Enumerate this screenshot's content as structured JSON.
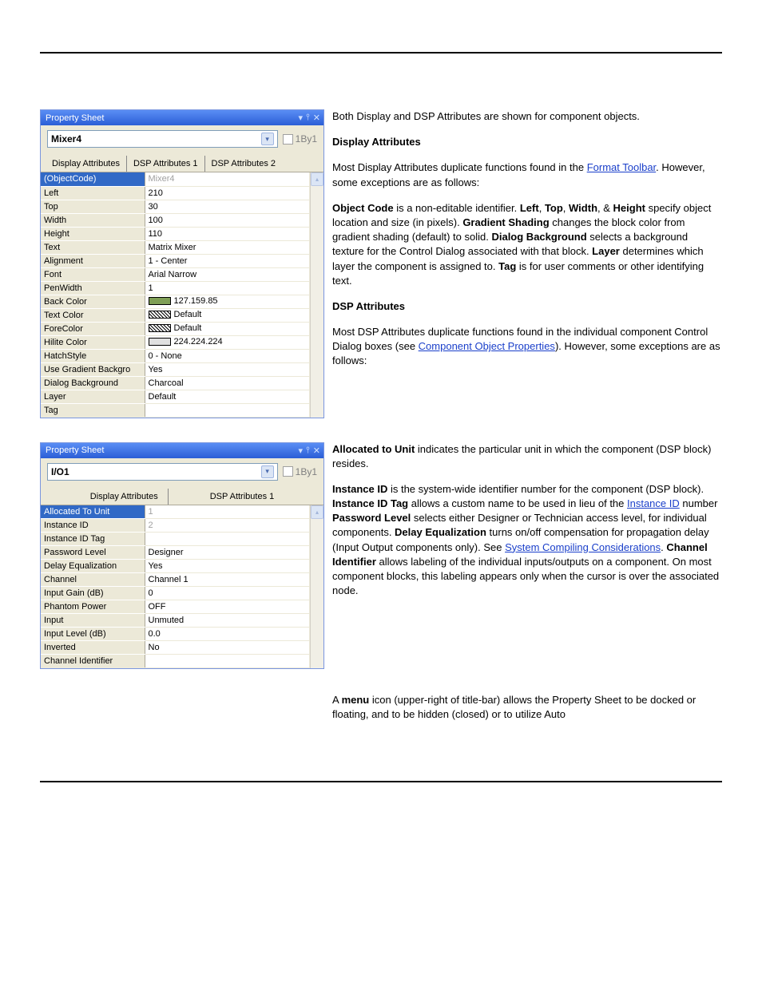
{
  "sheet1": {
    "title": "Property Sheet",
    "combo": "Mixer4",
    "by": "1By1",
    "tabs": [
      "Display Attributes",
      "DSP Attributes 1",
      "DSP Attributes 2"
    ],
    "rows": [
      {
        "name": "(ObjectCode)",
        "val": "Mixer4",
        "sel": true
      },
      {
        "name": "Left",
        "val": "210"
      },
      {
        "name": "Top",
        "val": "30"
      },
      {
        "name": "Width",
        "val": "100"
      },
      {
        "name": "Height",
        "val": "110"
      },
      {
        "name": "Text",
        "val": "Matrix Mixer"
      },
      {
        "name": "Alignment",
        "val": "1 - Center"
      },
      {
        "name": "Font",
        "val": "Arial Narrow"
      },
      {
        "name": "PenWidth",
        "val": "1"
      },
      {
        "name": "Back Color",
        "val": "127.159.85",
        "swatch": "#7f9f55"
      },
      {
        "name": "Text Color",
        "val": "Default",
        "swatch": "hatch"
      },
      {
        "name": "ForeColor",
        "val": "Default",
        "swatch": "hatch"
      },
      {
        "name": "Hilite Color",
        "val": "224.224.224",
        "swatch": "#e0e0e0"
      },
      {
        "name": "HatchStyle",
        "val": "0 - None"
      },
      {
        "name": "Use Gradient Backgro",
        "val": "Yes"
      },
      {
        "name": "Dialog Background",
        "val": "Charcoal"
      },
      {
        "name": "Layer",
        "val": "Default"
      },
      {
        "name": "Tag",
        "val": ""
      }
    ]
  },
  "sheet2": {
    "title": "Property Sheet",
    "combo": "I/O1",
    "by": "1By1",
    "tabs": [
      "Display Attributes",
      "DSP Attributes 1"
    ],
    "rows": [
      {
        "name": "Allocated To Unit",
        "val": "1",
        "sel": true
      },
      {
        "name": "Instance ID",
        "val": "2",
        "gray": true
      },
      {
        "name": "Instance ID Tag",
        "val": ""
      },
      {
        "name": "Password Level",
        "val": "Designer"
      },
      {
        "name": "Delay Equalization",
        "val": "Yes"
      },
      {
        "name": "Channel",
        "val": "Channel 1"
      },
      {
        "name": "Input Gain (dB)",
        "val": "0"
      },
      {
        "name": "Phantom Power",
        "val": "OFF"
      },
      {
        "name": "Input",
        "val": "Unmuted"
      },
      {
        "name": "Input Level (dB)",
        "val": "0.0"
      },
      {
        "name": "Inverted",
        "val": "No"
      },
      {
        "name": "Channel Identifier",
        "val": ""
      }
    ]
  },
  "txt": {
    "p1": "Both Display and DSP Attributes are shown for component objects.",
    "h1": "Display Attributes",
    "p2a": "Most Display Attributes duplicate functions found in the ",
    "link1": "Format Toolbar",
    "p2b": ". However, some exceptions are as follows:",
    "p3_oc": "Object Code",
    "p3_oc_t": " is a non-editable identifier. ",
    "p3_l": "Left",
    "p3_t": "Top",
    "p3_w": "Width",
    "p3_h": "Height",
    "p3_lt": ", ",
    "p3_amp": ", & ",
    "p3_end": " specify object location and size (in pixels). ",
    "p3_gs": "Gradient Shading",
    "p3_gs_t": " changes the block color from gradient shading (default) to solid. ",
    "p3_db": "Dialog Background",
    "p3_db_t": " selects a background texture for the Control Dialog associated with that block. ",
    "p3_ly": "Layer",
    "p3_ly_t": " determines which layer the component is assigned to. ",
    "p3_tg": "Tag",
    "p3_tg_t": " is for user comments or other identifying text.",
    "h2": "DSP Attributes",
    "p4a": "Most DSP Attributes duplicate functions found in the individual component Control Dialog boxes (see ",
    "link2": "Component Object Properties",
    "p4b": "). However, some exceptions are as follows:",
    "p5_au": "Allocated to Unit",
    "p5_au_t": " indicates the particular unit in which the component (DSP block) resides.",
    "p5_id": "Instance ID ",
    "p5_id_t": "is the system-wide identifier number for the component (DSP block). ",
    "p5_idt": "Instance ID Tag ",
    "p5_idt_t": "allows a custom name to be used in lieu of the ",
    "link3": "Instance ID",
    "p5_idt_t2": " number ",
    "p5_pl": "Password Level ",
    "p5_pl_t": "selects either Designer or Technician access level, for individual components. ",
    "p5_de": "Delay Equalization",
    "p5_de_t": " turns on/off compensation for propagation delay (Input Output components only). See ",
    "link4": "System Compiling Considerations",
    "p5_de_t2": ". ",
    "p5_ci": "Channel Identifier",
    "p5_ci_t": " allows labeling of the individual inputs/outputs on a component. On most component blocks, this labeling appears only when the cursor is over the associated node.",
    "p6a": "A ",
    "p6_menu": "menu",
    "p6b": " icon (upper-right of title-bar) allows the Property Sheet to be docked or floating, and to be hidden (closed) or to utilize Auto"
  }
}
